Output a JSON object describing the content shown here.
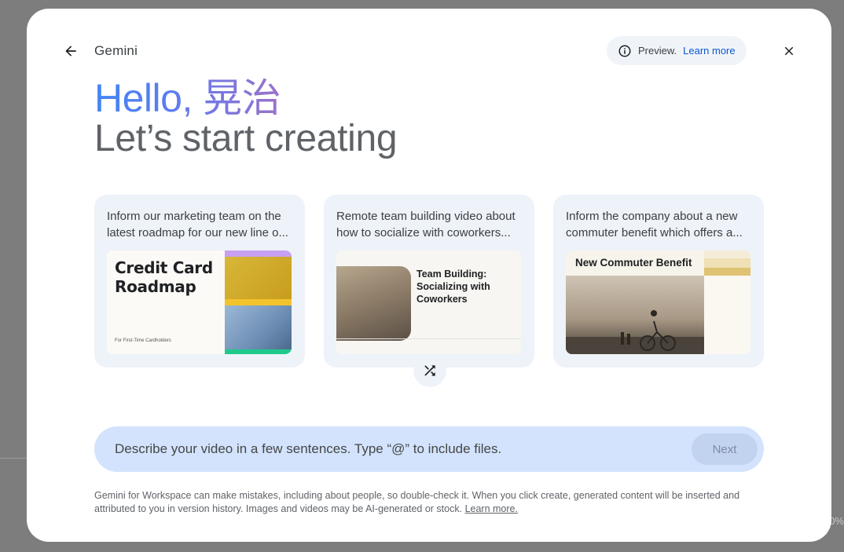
{
  "header": {
    "app_title": "Gemini",
    "preview_label": "Preview.",
    "preview_link": "Learn more"
  },
  "hero": {
    "greeting": "Hello, 晃治",
    "subtitle": "Let’s start creating"
  },
  "cards": [
    {
      "prompt": "Inform our marketing team on the latest roadmap for our new line o...",
      "thumb_title": "Credit Card Roadmap",
      "thumb_caption": "For First-Time Cardholders"
    },
    {
      "prompt": "Remote team building video about how to socialize with coworkers...",
      "thumb_title": "Team Building: Socializing with Coworkers"
    },
    {
      "prompt": "Inform the company about a new commuter benefit which offers a...",
      "thumb_title": "New Commuter Benefit"
    }
  ],
  "input": {
    "placeholder": "Describe your video in a few sentences. Type “@” to include files.",
    "next_label": "Next"
  },
  "footer": {
    "disclaimer": "Gemini for Workspace can make mistakes, including about people, so double-check it. When you click create, generated content will be inserted and attributed to you in version history. Images and videos may be AI-generated or stock.",
    "learn_more": "Learn more."
  },
  "background": {
    "percent_fragment": "0%"
  },
  "icons": {
    "back": "arrow-back-icon",
    "info": "info-icon",
    "close": "close-icon",
    "shuffle": "shuffle-icon"
  },
  "colors": {
    "accent_blue": "#4285f4",
    "accent_purple": "#9b72cb",
    "input_bg": "#d3e3fd",
    "link": "#0b57d0"
  }
}
